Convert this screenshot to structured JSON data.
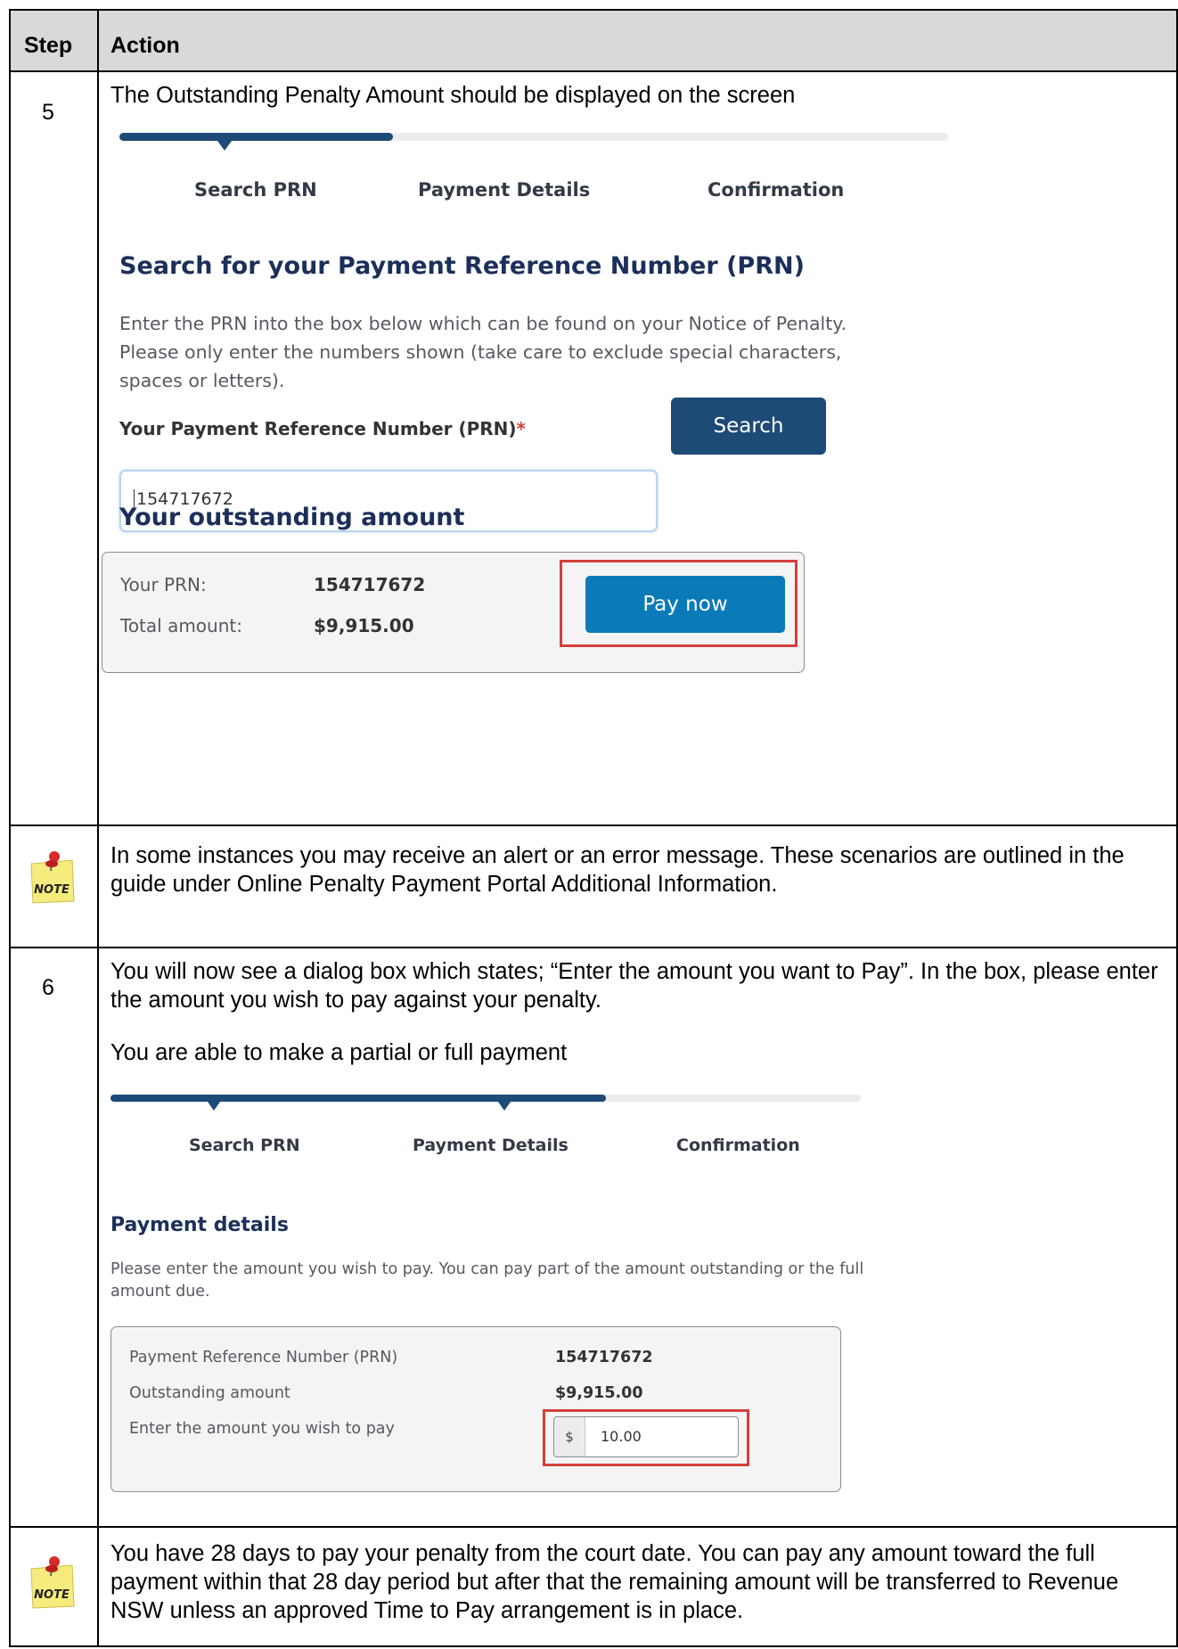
{
  "table": {
    "header": {
      "step": "Step",
      "action": "Action"
    },
    "rows": [
      {
        "step": "5",
        "text": "The Outstanding Penalty Amount should be displayed on the screen"
      },
      {
        "note_label": "NOTE",
        "text": "In some instances you may receive an alert or an error message. These scenarios are outlined in the guide under Online Penalty Payment Portal Additional Information."
      },
      {
        "step": "6",
        "text": "You will now see a dialog box which states; “Enter the amount you want to Pay”. In the box, please enter the amount you wish to pay against your penalty.",
        "text2": "You are able to make a partial or full payment"
      },
      {
        "note_label": "NOTE",
        "text": "You have 28 days to pay your penalty from the court date. You can pay any amount toward the full payment within that 28 day period but after that the remaining amount will be transferred to Revenue NSW unless an approved Time to Pay arrangement is in place."
      }
    ]
  },
  "screen1": {
    "steps": [
      "Search PRN",
      "Payment Details",
      "Confirmation"
    ],
    "progress": 0.33,
    "heading": "Search for your Payment Reference Number (PRN)",
    "description": "Enter the PRN into the box below which can be found on your Notice of Penalty. Please only enter the numbers shown (take care to exclude special characters, spaces or letters).",
    "field_label": "Your Payment Reference Number (PRN)",
    "required_mark": "*",
    "prn_value": "154717672",
    "search_button": "Search",
    "outstanding_heading": "Your outstanding amount",
    "prn_label": "Your PRN:",
    "prn_display": "154717672",
    "total_label": "Total amount:",
    "total_value": "$9,915.00",
    "pay_button": "Pay now",
    "colors": {
      "navy": "#1c2f5a",
      "search_btn": "#1d4a77",
      "pay_btn": "#0b7ab8",
      "highlight": "#d3403a"
    }
  },
  "screen2": {
    "steps": [
      "Search PRN",
      "Payment Details",
      "Confirmation"
    ],
    "progress": 0.66,
    "heading": "Payment details",
    "description": "Please enter the amount you wish to pay. You can pay part of the amount outstanding or the full amount due.",
    "rows": [
      {
        "label": "Payment Reference Number (PRN)",
        "value": "154717672"
      },
      {
        "label": "Outstanding amount",
        "value": "$9,915.00"
      },
      {
        "label": "Enter the amount you wish to pay"
      }
    ],
    "currency_symbol": "$",
    "amount_value": "10.00"
  }
}
